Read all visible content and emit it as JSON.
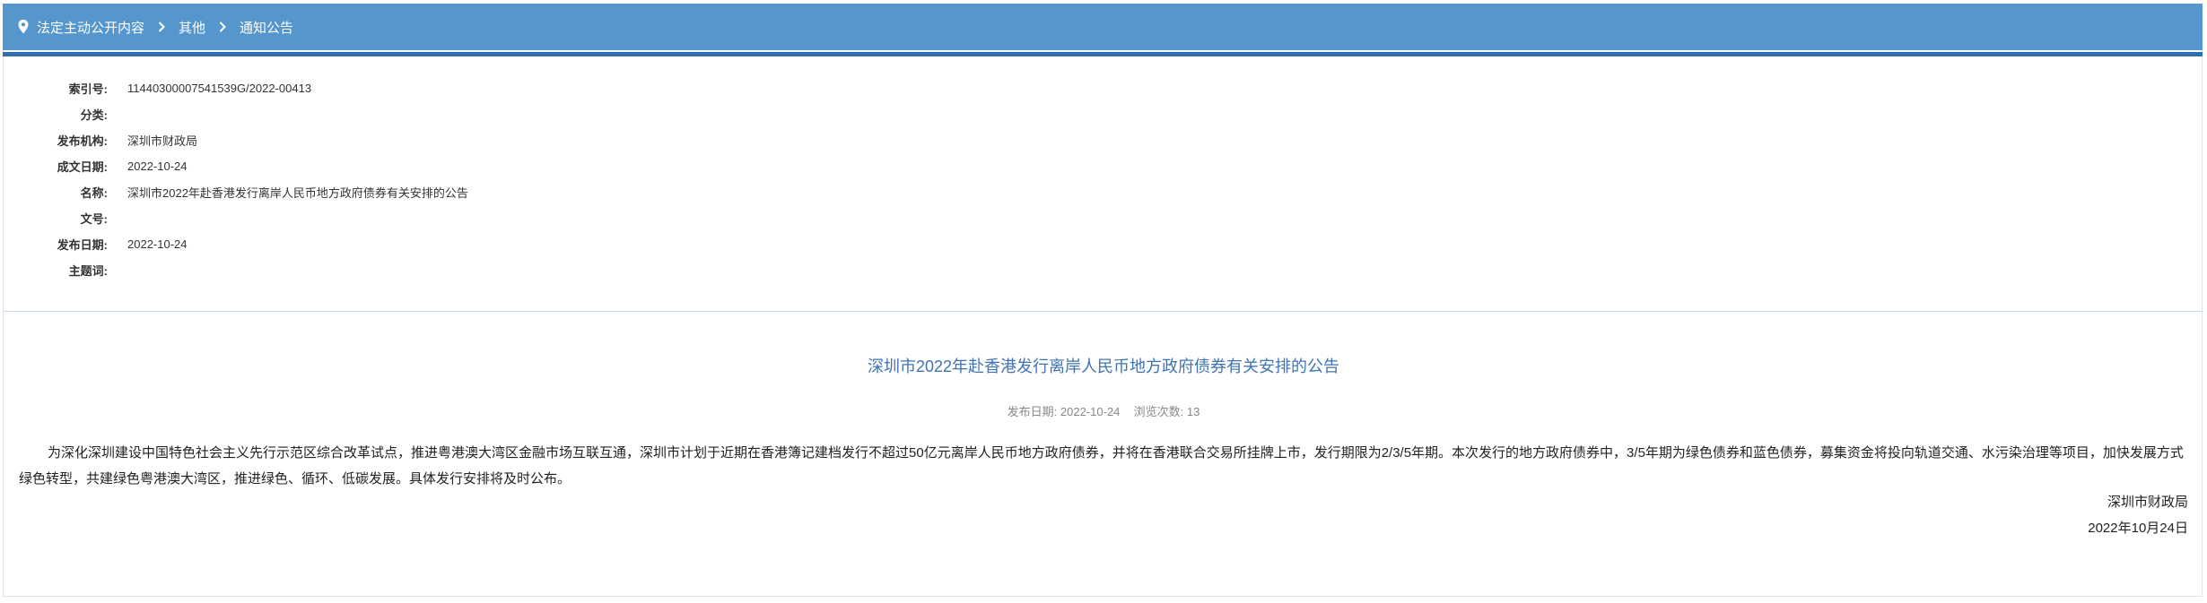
{
  "breadcrumb": {
    "items": [
      "法定主动公开内容",
      "其他",
      "通知公告"
    ]
  },
  "meta": {
    "rows": [
      {
        "key": "索引号:",
        "value": "11440300007541539G/2022-00413"
      },
      {
        "key": "分类:",
        "value": ""
      },
      {
        "key": "发布机构:",
        "value": "深圳市财政局"
      },
      {
        "key": "成文日期:",
        "value": "2022-10-24"
      },
      {
        "key": "名称:",
        "value": "深圳市2022年赴香港发行离岸人民币地方政府债券有关安排的公告"
      },
      {
        "key": "文号:",
        "value": ""
      },
      {
        "key": "发布日期:",
        "value": "2022-10-24"
      },
      {
        "key": "主题词:",
        "value": ""
      }
    ]
  },
  "article": {
    "title": "深圳市2022年赴香港发行离岸人民币地方政府债券有关安排的公告",
    "publish_label": "发布日期:",
    "publish_date": "2022-10-24",
    "views_label": "浏览次数:",
    "views": "13",
    "body": "为深化深圳建设中国特色社会主义先行示范区综合改革试点，推进粤港澳大湾区金融市场互联互通，深圳市计划于近期在香港簿记建档发行不超过50亿元离岸人民币地方政府债券，并将在香港联合交易所挂牌上市，发行期限为2/3/5年期。本次发行的地方政府债券中，3/5年期为绿色债券和蓝色债券，募集资金将投向轨道交通、水污染治理等项目，加快发展方式绿色转型，共建绿色粤港澳大湾区，推进绿色、循环、低碳发展。具体发行安排将及时公布。",
    "signature_org": "深圳市财政局",
    "signature_date": "2022年10月24日"
  },
  "colors": {
    "header_bg": "#5597cc",
    "accent": "#2f6fb0",
    "title": "#3f74b3"
  }
}
